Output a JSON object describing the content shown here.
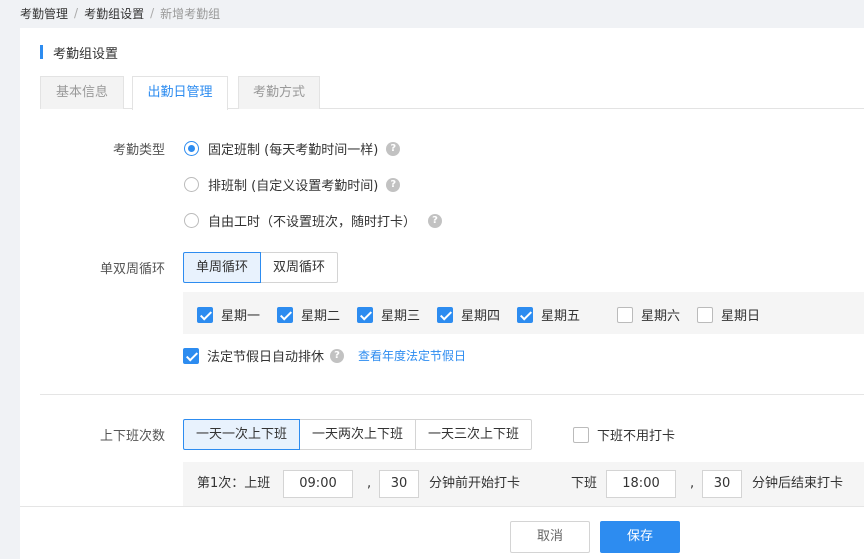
{
  "breadcrumb": {
    "items": [
      "考勤管理",
      "考勤组设置"
    ],
    "current": "新增考勤组",
    "separator": "/"
  },
  "section": {
    "title": "考勤组设置"
  },
  "tabs": [
    {
      "label": "基本信息",
      "active": false
    },
    {
      "label": "出勤日管理",
      "active": true
    },
    {
      "label": "考勤方式",
      "active": false
    }
  ],
  "attendance_type": {
    "label": "考勤类型",
    "options": [
      {
        "label": "固定班制 (每天考勤时间一样)",
        "selected": true
      },
      {
        "label": "排班制 (自定义设置考勤时间)",
        "selected": false
      },
      {
        "label": "自由工时（不设置班次，随时打卡）",
        "selected": false
      }
    ],
    "help_glyph": "?"
  },
  "week_cycle": {
    "label": "单双周循环",
    "options": [
      {
        "label": "单周循环",
        "active": true
      },
      {
        "label": "双周循环",
        "active": false
      }
    ]
  },
  "weekdays": [
    {
      "label": "星期一",
      "checked": true
    },
    {
      "label": "星期二",
      "checked": true
    },
    {
      "label": "星期三",
      "checked": true
    },
    {
      "label": "星期四",
      "checked": true
    },
    {
      "label": "星期五",
      "checked": true
    },
    {
      "label": "星期六",
      "checked": false
    },
    {
      "label": "星期日",
      "checked": false
    }
  ],
  "holiday": {
    "label": "法定节假日自动排休",
    "checked": true,
    "link": "查看年度法定节假日"
  },
  "shifts": {
    "label": "上下班次数",
    "options": [
      {
        "label": "一天一次上下班",
        "active": true
      },
      {
        "label": "一天两次上下班",
        "active": false
      },
      {
        "label": "一天三次上下班",
        "active": false
      }
    ],
    "no_clock_out": {
      "label": "下班不用打卡",
      "checked": false
    }
  },
  "shift_row": {
    "prefix": "第1次：上班",
    "start_time": "09:00",
    "comma": ",",
    "start_minutes": "30",
    "start_suffix": "分钟前开始打卡",
    "end_label": "下班",
    "end_time": "18:00",
    "end_minutes": "30",
    "end_suffix": "分钟后结束打卡"
  },
  "footer": {
    "cancel_label": "取消",
    "save_label": "保存"
  },
  "colors": {
    "accent": "#2d8cf0",
    "segment_active_bg": "#e8f2fd",
    "row_bg": "#f5f5f5"
  }
}
